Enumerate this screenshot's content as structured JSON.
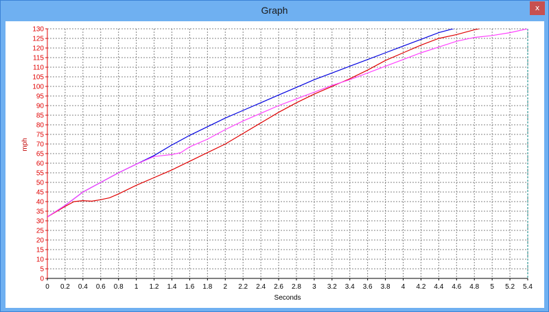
{
  "window": {
    "title": "Graph",
    "close_glyph": "x"
  },
  "chart_data": {
    "type": "line",
    "title": "",
    "xlabel": "Seconds",
    "ylabel": "mph",
    "xlim": [
      0,
      5.4
    ],
    "ylim": [
      0,
      130
    ],
    "x_ticks": [
      "0",
      "0.2",
      "0.4",
      "0.6",
      "0.8",
      "1",
      "1.2",
      "1.4",
      "1.6",
      "1.8",
      "2",
      "2.2",
      "2.4",
      "2.6",
      "2.8",
      "3",
      "3.2",
      "3.4",
      "3.6",
      "3.8",
      "4",
      "4.2",
      "4.4",
      "4.6",
      "4.8",
      "5",
      "5.2",
      "5.4"
    ],
    "y_ticks": [
      "0",
      "5",
      "10",
      "15",
      "20",
      "25",
      "30",
      "35",
      "40",
      "45",
      "50",
      "55",
      "60",
      "65",
      "70",
      "75",
      "80",
      "85",
      "90",
      "95",
      "100",
      "105",
      "110",
      "115",
      "120",
      "125",
      "130"
    ],
    "grid": true,
    "colors": {
      "axis_y": "#e00000",
      "axis_x": "#000000",
      "grid": "#808080"
    },
    "series": [
      {
        "color": "#0000e0",
        "x": [
          0,
          0.2,
          0.4,
          0.6,
          0.8,
          1.0,
          1.2,
          1.4,
          1.6,
          1.8,
          2.0,
          2.2,
          2.4,
          2.6,
          2.8,
          3.0,
          3.2,
          3.4,
          3.6,
          3.8,
          4.0,
          4.2,
          4.4,
          4.6
        ],
        "y": [
          32,
          38,
          45,
          50,
          55,
          59.5,
          64,
          69.5,
          74.5,
          79,
          83.5,
          87.5,
          91.5,
          95.5,
          99.5,
          103.5,
          107,
          110.5,
          114,
          117.5,
          121,
          124.5,
          128,
          130.5
        ]
      },
      {
        "color": "#e00000",
        "x": [
          0,
          0.2,
          0.3,
          0.4,
          0.5,
          0.6,
          0.7,
          0.8,
          1.0,
          1.2,
          1.4,
          1.6,
          1.8,
          2.0,
          2.2,
          2.4,
          2.6,
          2.8,
          3.0,
          3.2,
          3.4,
          3.6,
          3.8,
          4.0,
          4.2,
          4.4,
          4.6,
          4.8,
          4.9
        ],
        "y": [
          32,
          37.5,
          40,
          40.5,
          40.2,
          41,
          42,
          44,
          48.5,
          52.5,
          56.5,
          61,
          65.5,
          70,
          75.5,
          81,
          86.5,
          91.5,
          96,
          100,
          104,
          108.5,
          113.5,
          117.5,
          121.5,
          125,
          127,
          129.5,
          130.5
        ]
      },
      {
        "color": "#ff40ff",
        "x": [
          0,
          0.2,
          0.4,
          0.6,
          0.8,
          1.0,
          1.2,
          1.3,
          1.4,
          1.5,
          1.6,
          1.8,
          2.0,
          2.2,
          2.4,
          2.6,
          2.8,
          3.0,
          3.2,
          3.4,
          3.6,
          3.8,
          4.0,
          4.2,
          4.4,
          4.6,
          4.8,
          5.0,
          5.2,
          5.4
        ],
        "y": [
          32,
          38,
          45,
          50,
          55,
          59.5,
          63.5,
          64,
          64.5,
          65.5,
          68.5,
          72.5,
          77.5,
          82,
          86,
          90,
          93.5,
          97,
          100.5,
          103.5,
          107,
          110.5,
          114,
          117.5,
          120.5,
          123.5,
          125.5,
          126.5,
          128,
          130
        ]
      }
    ]
  }
}
